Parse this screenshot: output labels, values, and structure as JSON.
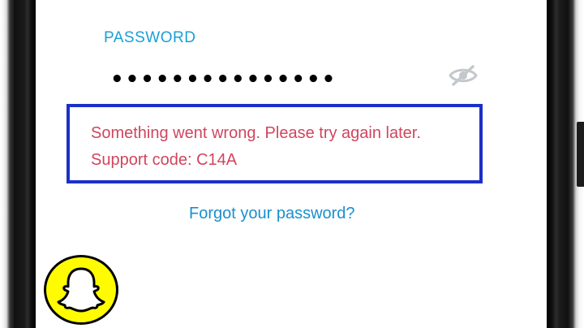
{
  "password_field": {
    "label": "PASSWORD",
    "masked_value": "•••••••••••••••",
    "visibility_icon": "eye-slash-icon"
  },
  "error": {
    "message": "Something went wrong. Please try again later. Support code: C14A"
  },
  "forgot_password": {
    "label": "Forgot your password?"
  },
  "logo": {
    "name": "snapchat-ghost-logo"
  },
  "colors": {
    "label_accent": "#1aa0d6",
    "error_text": "#d0455d",
    "highlight_border": "#1b2fc9",
    "link": "#1a8fd0",
    "logo_yellow": "#fffc00"
  }
}
